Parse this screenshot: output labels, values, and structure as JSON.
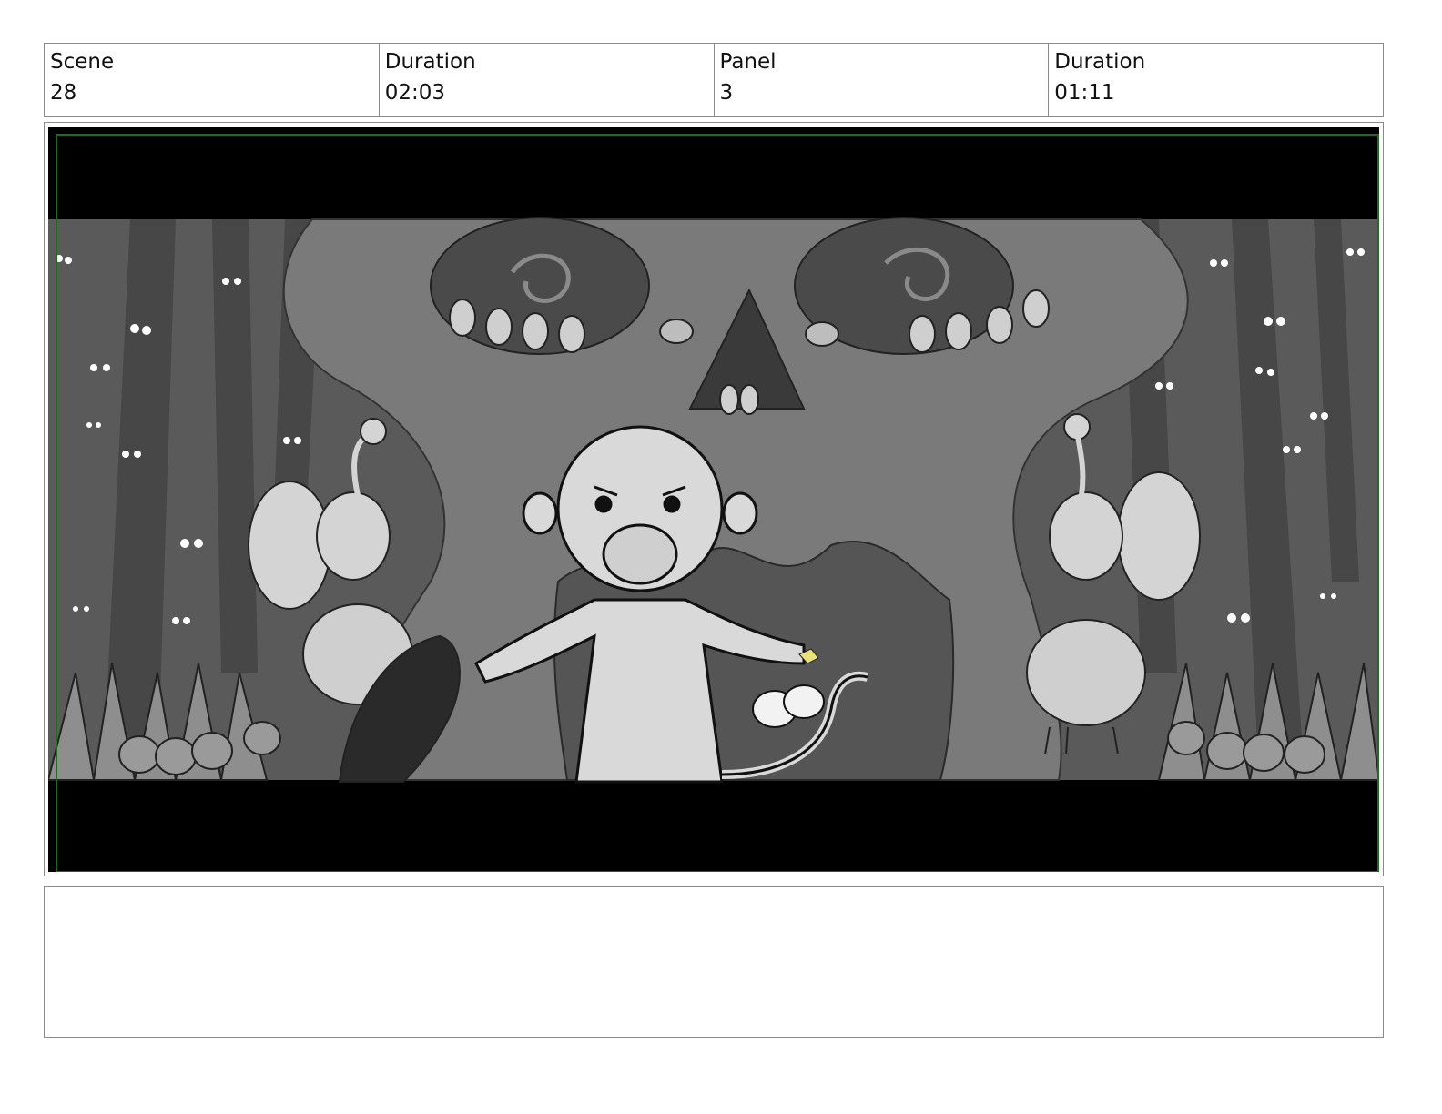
{
  "header": {
    "scene_label": "Scene",
    "scene_value": "28",
    "scene_duration_label": "Duration",
    "scene_duration_value": "02:03",
    "panel_label": "Panel",
    "panel_value": "3",
    "panel_duration_label": "Duration",
    "panel_duration_value": "01:11"
  },
  "notes": {
    "text": ""
  },
  "colors": {
    "border": "#8a8a8a",
    "safe_frame": "#1f6b1f",
    "letterbox": "#000000",
    "accent_yellow": "#e8e27a"
  }
}
